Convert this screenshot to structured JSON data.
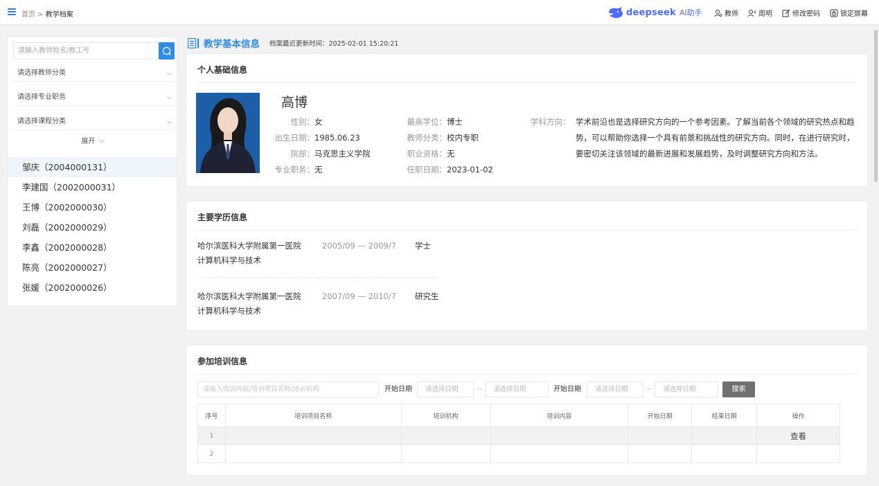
{
  "header": {
    "breadcrumb_home": "首页",
    "breadcrumb_sep": " > ",
    "breadcrumb_current": "教学档案",
    "brand_name": "deepseek",
    "brand_ai": "AI助手",
    "actions": [
      {
        "icon": "user-icon",
        "label": "教师"
      },
      {
        "icon": "user-list-icon",
        "label": "周明"
      },
      {
        "icon": "edit-icon",
        "label": "修改密码"
      },
      {
        "icon": "lock-icon",
        "label": "锁定屏幕"
      }
    ],
    "accent_color": "#2e8de6",
    "brand_color": "#4d6bfe"
  },
  "sidebar": {
    "search_placeholder": "请输入教师姓名/教工号",
    "selects": [
      "请选择教师分类",
      "请选择专业职务",
      "请选择课程分类"
    ],
    "expand_label": "展开",
    "teachers": [
      "邹庆（2004000131）",
      "李建国（2002000031）",
      "王博（2002000030）",
      "刘磊（2002000029）",
      "李鑫（2002000028）",
      "陈亮（2002000027）",
      "张媛（2002000026）"
    ],
    "active_index": 0
  },
  "main": {
    "section_title": "教学基本信息",
    "updated_label": "档案最近更新时间：",
    "updated_time": "2025-02-01 15:20:21",
    "personal": {
      "title": "个人基础信息",
      "name": "高博",
      "fields": [
        {
          "label": "性别：",
          "value": "女"
        },
        {
          "label": "出生日期：",
          "value": "1985.06.23"
        },
        {
          "label": "院部：",
          "value": "马克思主义学院"
        },
        {
          "label": "专业职务：",
          "value": "无"
        },
        {
          "label": "最高学位：",
          "value": "博士"
        },
        {
          "label": "教师分类：",
          "value": "校内专职"
        },
        {
          "label": "职业资格：",
          "value": "无"
        },
        {
          "label": "任职日期：",
          "value": "2023-01-02"
        }
      ],
      "direction_label": "学科方向：",
      "direction_text": "学术前沿也是选择研究方向的一个参考因素。了解当前各个领域的研究热点和趋势，可以帮助你选择一个具有前景和挑战性的研究方向。同时，在进行研究时，要密切关注该领域的最新进展和发展趋势，及时调整研究方向和方法。"
    },
    "education": {
      "title": "主要学历信息",
      "items": [
        {
          "school": "哈尔滨医科大学附属第一医院",
          "period": "2005/09 — 2009/7",
          "degree": "学士",
          "major": "计算机科学与技术"
        },
        {
          "school": "哈尔滨医科大学附属第一医院",
          "period": "2007/09 — 2010/7",
          "degree": "研究生",
          "major": "计算机科学与技术"
        }
      ]
    },
    "training": {
      "title": "参加培训信息",
      "keyword_placeholder": "请输入培训内容/培训项目名称/培训机构",
      "date_label_1": "开始日期",
      "date_label_2": "开始日期",
      "date_placeholder": "请选择日期",
      "tilde": "~",
      "search_label": "搜索",
      "columns": [
        "序号",
        "培训项目名称",
        "培训机构",
        "培训内容",
        "开始日期",
        "结束日期",
        "操作"
      ],
      "rows": [
        {
          "index": "1",
          "action": "查看"
        },
        {
          "index": "2",
          "action": ""
        }
      ]
    }
  }
}
